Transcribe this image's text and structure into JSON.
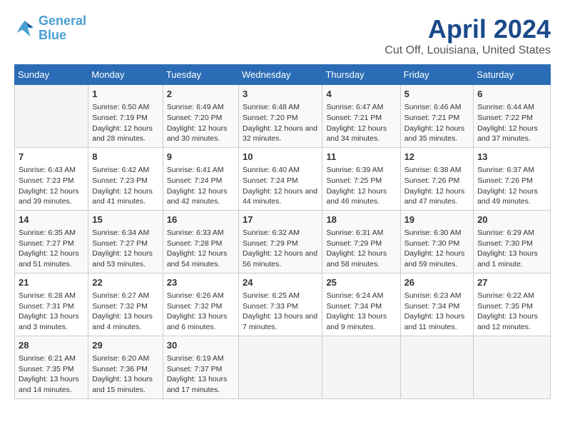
{
  "logo": {
    "line1": "General",
    "line2": "Blue"
  },
  "title": "April 2024",
  "subtitle": "Cut Off, Louisiana, United States",
  "weekdays": [
    "Sunday",
    "Monday",
    "Tuesday",
    "Wednesday",
    "Thursday",
    "Friday",
    "Saturday"
  ],
  "weeks": [
    [
      {
        "day": "",
        "sunrise": "",
        "sunset": "",
        "daylight": ""
      },
      {
        "day": "1",
        "sunrise": "Sunrise: 6:50 AM",
        "sunset": "Sunset: 7:19 PM",
        "daylight": "Daylight: 12 hours and 28 minutes."
      },
      {
        "day": "2",
        "sunrise": "Sunrise: 6:49 AM",
        "sunset": "Sunset: 7:20 PM",
        "daylight": "Daylight: 12 hours and 30 minutes."
      },
      {
        "day": "3",
        "sunrise": "Sunrise: 6:48 AM",
        "sunset": "Sunset: 7:20 PM",
        "daylight": "Daylight: 12 hours and 32 minutes."
      },
      {
        "day": "4",
        "sunrise": "Sunrise: 6:47 AM",
        "sunset": "Sunset: 7:21 PM",
        "daylight": "Daylight: 12 hours and 34 minutes."
      },
      {
        "day": "5",
        "sunrise": "Sunrise: 6:46 AM",
        "sunset": "Sunset: 7:21 PM",
        "daylight": "Daylight: 12 hours and 35 minutes."
      },
      {
        "day": "6",
        "sunrise": "Sunrise: 6:44 AM",
        "sunset": "Sunset: 7:22 PM",
        "daylight": "Daylight: 12 hours and 37 minutes."
      }
    ],
    [
      {
        "day": "7",
        "sunrise": "Sunrise: 6:43 AM",
        "sunset": "Sunset: 7:23 PM",
        "daylight": "Daylight: 12 hours and 39 minutes."
      },
      {
        "day": "8",
        "sunrise": "Sunrise: 6:42 AM",
        "sunset": "Sunset: 7:23 PM",
        "daylight": "Daylight: 12 hours and 41 minutes."
      },
      {
        "day": "9",
        "sunrise": "Sunrise: 6:41 AM",
        "sunset": "Sunset: 7:24 PM",
        "daylight": "Daylight: 12 hours and 42 minutes."
      },
      {
        "day": "10",
        "sunrise": "Sunrise: 6:40 AM",
        "sunset": "Sunset: 7:24 PM",
        "daylight": "Daylight: 12 hours and 44 minutes."
      },
      {
        "day": "11",
        "sunrise": "Sunrise: 6:39 AM",
        "sunset": "Sunset: 7:25 PM",
        "daylight": "Daylight: 12 hours and 46 minutes."
      },
      {
        "day": "12",
        "sunrise": "Sunrise: 6:38 AM",
        "sunset": "Sunset: 7:26 PM",
        "daylight": "Daylight: 12 hours and 47 minutes."
      },
      {
        "day": "13",
        "sunrise": "Sunrise: 6:37 AM",
        "sunset": "Sunset: 7:26 PM",
        "daylight": "Daylight: 12 hours and 49 minutes."
      }
    ],
    [
      {
        "day": "14",
        "sunrise": "Sunrise: 6:35 AM",
        "sunset": "Sunset: 7:27 PM",
        "daylight": "Daylight: 12 hours and 51 minutes."
      },
      {
        "day": "15",
        "sunrise": "Sunrise: 6:34 AM",
        "sunset": "Sunset: 7:27 PM",
        "daylight": "Daylight: 12 hours and 53 minutes."
      },
      {
        "day": "16",
        "sunrise": "Sunrise: 6:33 AM",
        "sunset": "Sunset: 7:28 PM",
        "daylight": "Daylight: 12 hours and 54 minutes."
      },
      {
        "day": "17",
        "sunrise": "Sunrise: 6:32 AM",
        "sunset": "Sunset: 7:29 PM",
        "daylight": "Daylight: 12 hours and 56 minutes."
      },
      {
        "day": "18",
        "sunrise": "Sunrise: 6:31 AM",
        "sunset": "Sunset: 7:29 PM",
        "daylight": "Daylight: 12 hours and 58 minutes."
      },
      {
        "day": "19",
        "sunrise": "Sunrise: 6:30 AM",
        "sunset": "Sunset: 7:30 PM",
        "daylight": "Daylight: 12 hours and 59 minutes."
      },
      {
        "day": "20",
        "sunrise": "Sunrise: 6:29 AM",
        "sunset": "Sunset: 7:30 PM",
        "daylight": "Daylight: 13 hours and 1 minute."
      }
    ],
    [
      {
        "day": "21",
        "sunrise": "Sunrise: 6:28 AM",
        "sunset": "Sunset: 7:31 PM",
        "daylight": "Daylight: 13 hours and 3 minutes."
      },
      {
        "day": "22",
        "sunrise": "Sunrise: 6:27 AM",
        "sunset": "Sunset: 7:32 PM",
        "daylight": "Daylight: 13 hours and 4 minutes."
      },
      {
        "day": "23",
        "sunrise": "Sunrise: 6:26 AM",
        "sunset": "Sunset: 7:32 PM",
        "daylight": "Daylight: 13 hours and 6 minutes."
      },
      {
        "day": "24",
        "sunrise": "Sunrise: 6:25 AM",
        "sunset": "Sunset: 7:33 PM",
        "daylight": "Daylight: 13 hours and 7 minutes."
      },
      {
        "day": "25",
        "sunrise": "Sunrise: 6:24 AM",
        "sunset": "Sunset: 7:34 PM",
        "daylight": "Daylight: 13 hours and 9 minutes."
      },
      {
        "day": "26",
        "sunrise": "Sunrise: 6:23 AM",
        "sunset": "Sunset: 7:34 PM",
        "daylight": "Daylight: 13 hours and 11 minutes."
      },
      {
        "day": "27",
        "sunrise": "Sunrise: 6:22 AM",
        "sunset": "Sunset: 7:35 PM",
        "daylight": "Daylight: 13 hours and 12 minutes."
      }
    ],
    [
      {
        "day": "28",
        "sunrise": "Sunrise: 6:21 AM",
        "sunset": "Sunset: 7:35 PM",
        "daylight": "Daylight: 13 hours and 14 minutes."
      },
      {
        "day": "29",
        "sunrise": "Sunrise: 6:20 AM",
        "sunset": "Sunset: 7:36 PM",
        "daylight": "Daylight: 13 hours and 15 minutes."
      },
      {
        "day": "30",
        "sunrise": "Sunrise: 6:19 AM",
        "sunset": "Sunset: 7:37 PM",
        "daylight": "Daylight: 13 hours and 17 minutes."
      },
      {
        "day": "",
        "sunrise": "",
        "sunset": "",
        "daylight": ""
      },
      {
        "day": "",
        "sunrise": "",
        "sunset": "",
        "daylight": ""
      },
      {
        "day": "",
        "sunrise": "",
        "sunset": "",
        "daylight": ""
      },
      {
        "day": "",
        "sunrise": "",
        "sunset": "",
        "daylight": ""
      }
    ]
  ]
}
